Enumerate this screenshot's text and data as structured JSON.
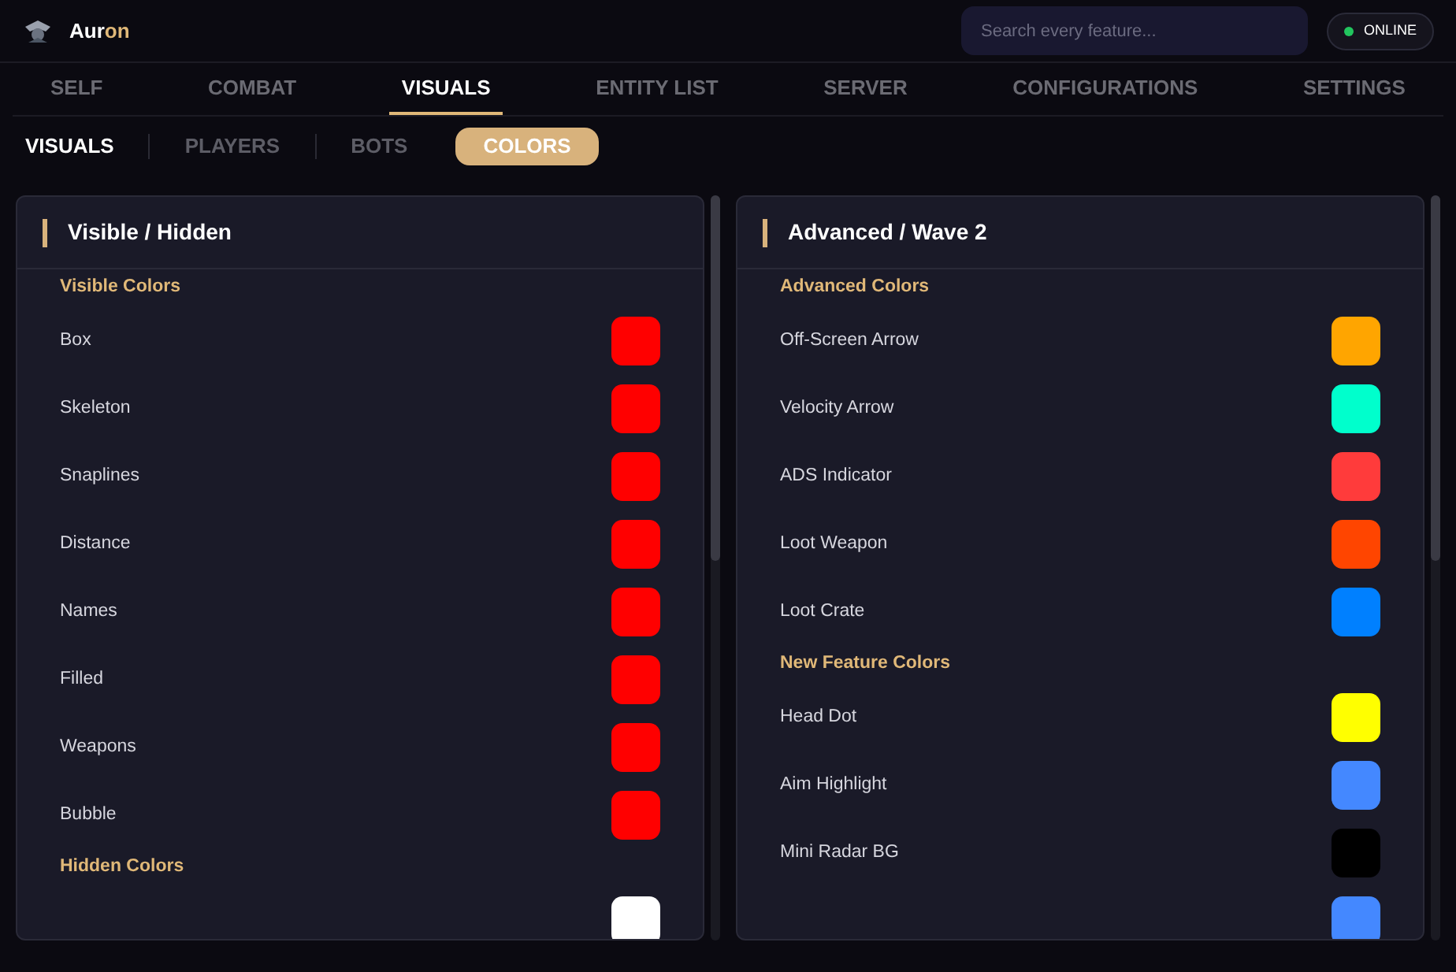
{
  "brand": {
    "name": "Aur",
    "accent": "on"
  },
  "search": {
    "placeholder": "Search every feature..."
  },
  "status": {
    "label": "ONLINE",
    "online": true
  },
  "tabs": [
    {
      "label": "SELF",
      "selected": false
    },
    {
      "label": "COMBAT",
      "selected": false
    },
    {
      "label": "VISUALS",
      "selected": true
    },
    {
      "label": "ENTITY LIST",
      "selected": false
    },
    {
      "label": "SERVER",
      "selected": false
    },
    {
      "label": "CONFIGURATIONS",
      "selected": false
    },
    {
      "label": "SETTINGS",
      "selected": false
    }
  ],
  "subtabs": [
    {
      "label": "VISUALS",
      "kind": "plain",
      "selected": true
    },
    {
      "label": "PLAYERS",
      "kind": "plain",
      "selected": false
    },
    {
      "label": "BOTS",
      "kind": "plain",
      "selected": false
    },
    {
      "label": "COLORS",
      "kind": "pill",
      "selected": true
    }
  ],
  "panels": [
    {
      "title": "Visible / Hidden",
      "items": [
        {
          "kind": "section",
          "label": "Visible Colors"
        },
        {
          "kind": "color",
          "label": "Box",
          "color": "#ff0000"
        },
        {
          "kind": "color",
          "label": "Skeleton",
          "color": "#ff0000"
        },
        {
          "kind": "color",
          "label": "Snaplines",
          "color": "#ff0000"
        },
        {
          "kind": "color",
          "label": "Distance",
          "color": "#ff0000"
        },
        {
          "kind": "color",
          "label": "Names",
          "color": "#ff0000"
        },
        {
          "kind": "color",
          "label": "Filled",
          "color": "#ff0000"
        },
        {
          "kind": "color",
          "label": "Weapons",
          "color": "#ff0000"
        },
        {
          "kind": "color",
          "label": "Bubble",
          "color": "#ff0000"
        },
        {
          "kind": "section",
          "label": "Hidden Colors"
        },
        {
          "kind": "color",
          "color": "#ffffff"
        }
      ]
    },
    {
      "title": "Advanced / Wave 2",
      "items": [
        {
          "kind": "section",
          "label": "Advanced Colors"
        },
        {
          "kind": "color",
          "label": "Off-Screen Arrow",
          "color": "#ffa500"
        },
        {
          "kind": "color",
          "label": "Velocity Arrow",
          "color": "#00ffcc"
        },
        {
          "kind": "color",
          "label": "ADS Indicator",
          "color": "#ff3b3b"
        },
        {
          "kind": "color",
          "label": "Loot Weapon",
          "color": "#ff4500"
        },
        {
          "kind": "color",
          "label": "Loot Crate",
          "color": "#0080ff"
        },
        {
          "kind": "section",
          "label": "New Feature Colors"
        },
        {
          "kind": "color",
          "label": "Head Dot",
          "color": "#ffff00"
        },
        {
          "kind": "color",
          "label": "Aim Highlight",
          "color": "#4488ff"
        },
        {
          "kind": "color",
          "label": "Mini Radar BG",
          "color": "#000000"
        },
        {
          "kind": "color",
          "color": "#4488ff"
        }
      ]
    }
  ]
}
